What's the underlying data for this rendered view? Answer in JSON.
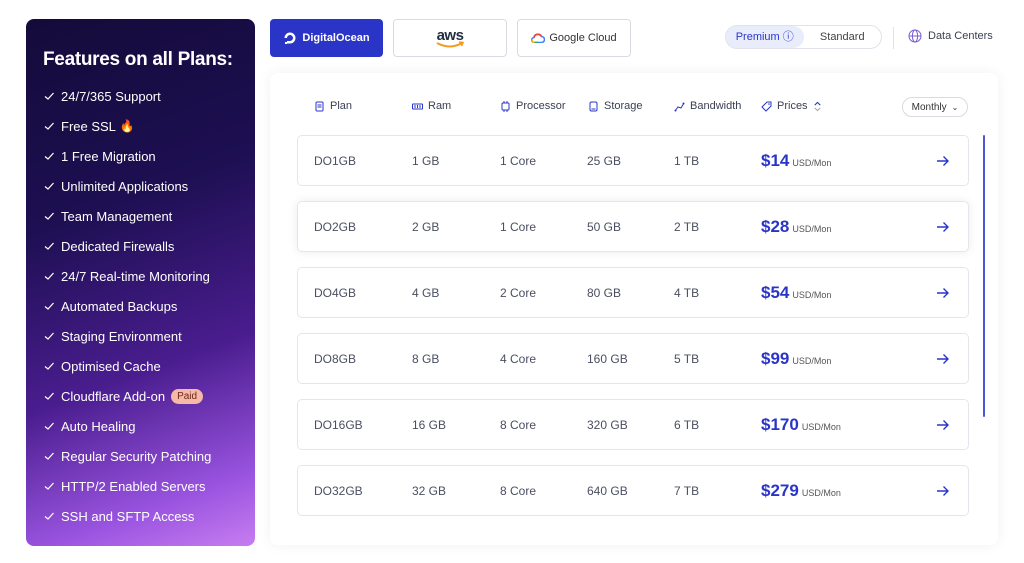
{
  "features": {
    "title": "Features on all Plans:",
    "items": [
      {
        "label": "24/7/365 Support"
      },
      {
        "label": "Free SSL",
        "emoji": "🔥"
      },
      {
        "label": "1 Free Migration"
      },
      {
        "label": "Unlimited Applications"
      },
      {
        "label": "Team Management"
      },
      {
        "label": "Dedicated Firewalls"
      },
      {
        "label": "24/7 Real-time Monitoring"
      },
      {
        "label": "Automated Backups"
      },
      {
        "label": "Staging Environment"
      },
      {
        "label": "Optimised Cache"
      },
      {
        "label": "Cloudflare Add-on",
        "badge": "Paid"
      },
      {
        "label": "Auto Healing"
      },
      {
        "label": "Regular Security Patching"
      },
      {
        "label": "HTTP/2 Enabled Servers"
      },
      {
        "label": "SSH and SFTP Access"
      }
    ]
  },
  "providers": {
    "digitalocean": "DigitalOcean",
    "aws": "aws",
    "google": "Google Cloud",
    "selected": "DigitalOcean"
  },
  "tier_toggle": {
    "premium": "Premium",
    "standard": "Standard",
    "selected": "Premium"
  },
  "data_centers": "Data Centers",
  "table": {
    "headers": {
      "plan": "Plan",
      "ram": "Ram",
      "processor": "Processor",
      "storage": "Storage",
      "bandwidth": "Bandwidth",
      "prices": "Prices"
    },
    "period": "Monthly",
    "rows": [
      {
        "plan": "DO1GB",
        "ram": "1 GB",
        "processor": "1 Core",
        "storage": "25 GB",
        "bandwidth": "1 TB",
        "price": "$14",
        "unit": "USD/Mon"
      },
      {
        "plan": "DO2GB",
        "ram": "2 GB",
        "processor": "1 Core",
        "storage": "50 GB",
        "bandwidth": "2 TB",
        "price": "$28",
        "unit": "USD/Mon"
      },
      {
        "plan": "DO4GB",
        "ram": "4 GB",
        "processor": "2 Core",
        "storage": "80 GB",
        "bandwidth": "4 TB",
        "price": "$54",
        "unit": "USD/Mon"
      },
      {
        "plan": "DO8GB",
        "ram": "8 GB",
        "processor": "4 Core",
        "storage": "160 GB",
        "bandwidth": "5 TB",
        "price": "$99",
        "unit": "USD/Mon"
      },
      {
        "plan": "DO16GB",
        "ram": "16 GB",
        "processor": "8 Core",
        "storage": "320 GB",
        "bandwidth": "6 TB",
        "price": "$170",
        "unit": "USD/Mon"
      },
      {
        "plan": "DO32GB",
        "ram": "32 GB",
        "processor": "8 Core",
        "storage": "640 GB",
        "bandwidth": "7 TB",
        "price": "$279",
        "unit": "USD/Mon"
      }
    ]
  },
  "colors": {
    "accent": "#2a35c8",
    "panel_top": "#140b3a",
    "panel_bottom": "#c77df0"
  }
}
